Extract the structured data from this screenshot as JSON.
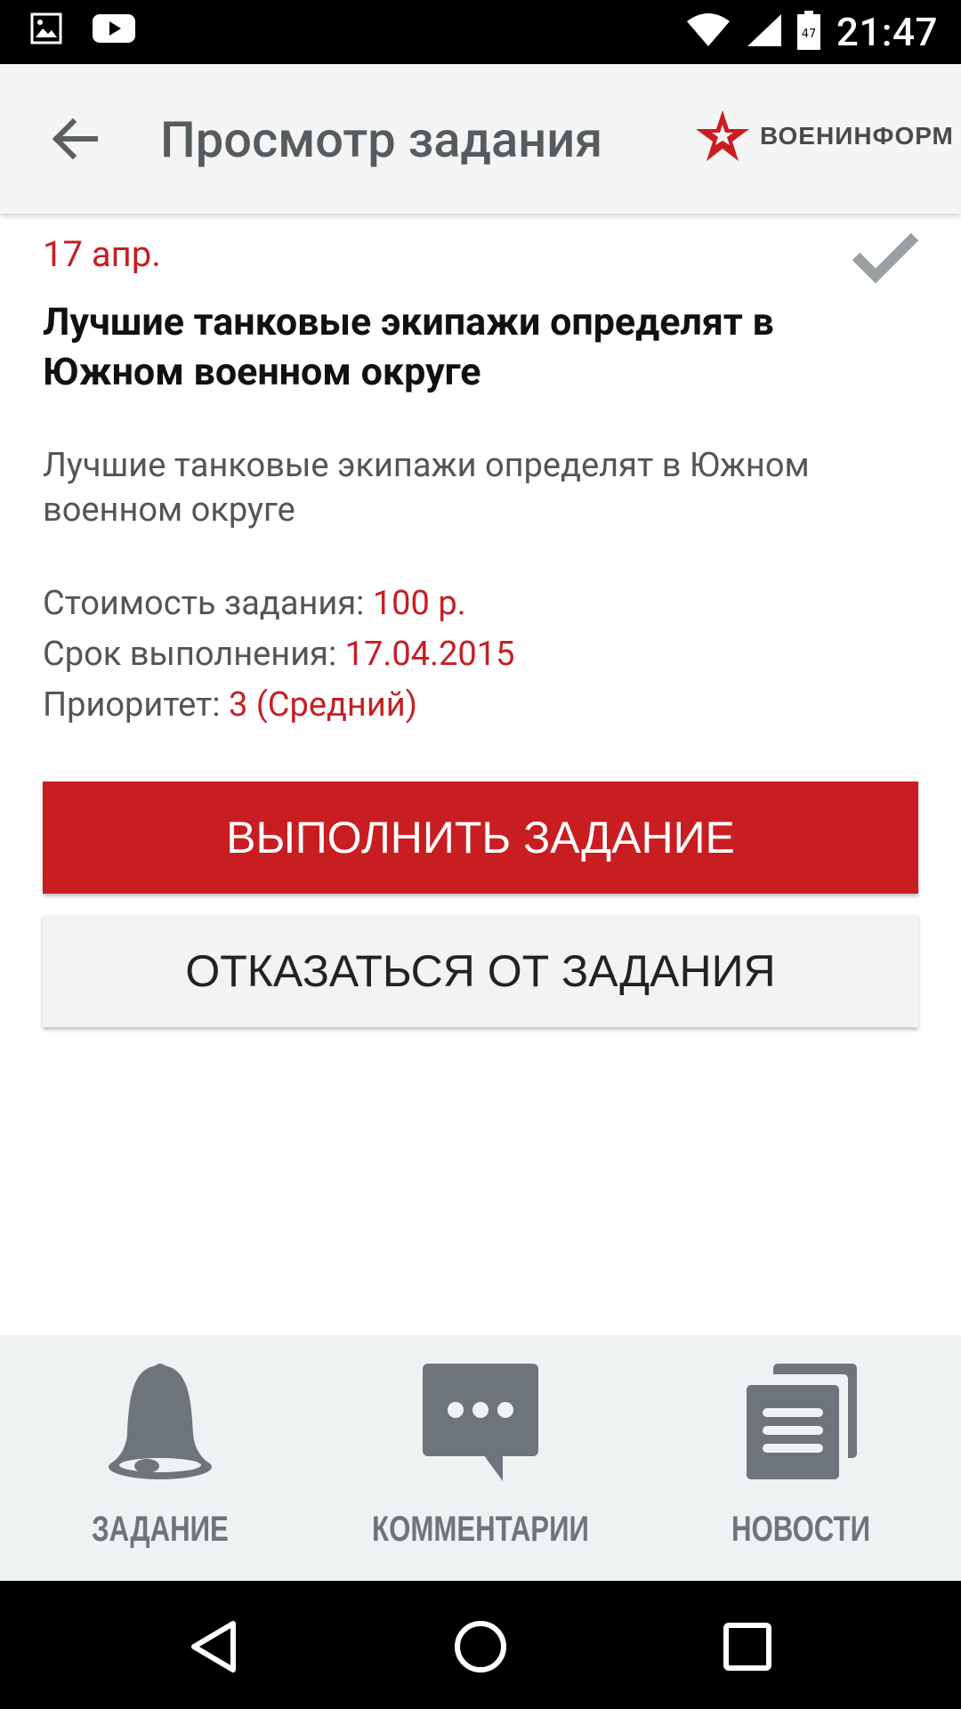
{
  "status_bar": {
    "time": "21:47",
    "left_icons": [
      "image-icon",
      "youtube-icon"
    ],
    "right_icons": [
      "wifi-icon",
      "signal-icon",
      "battery-icon"
    ],
    "battery_level": "47"
  },
  "app_bar": {
    "title": "Просмотр задания",
    "brand": "ВОЕНИНФОРМ"
  },
  "task": {
    "date": "17 апр.",
    "title": "Лучшие танковые экипажи определят в Южном военном округе",
    "description": "Лучшие танковые экипажи определят в Южном военном округе",
    "cost_label": "Стоимость задания: ",
    "cost_value": "100 р.",
    "deadline_label": "Срок выполнения: ",
    "deadline_value": "17.04.2015",
    "priority_label": "Приоритет: ",
    "priority_value": "3 (Средний)"
  },
  "actions": {
    "complete": "ВЫПОЛНИТЬ ЗАДАНИЕ",
    "decline": "ОТКАЗАТЬСЯ ОТ ЗАДАНИЯ"
  },
  "bottom_nav": {
    "items": [
      {
        "label": "ЗАДАНИЕ",
        "icon": "bell-icon"
      },
      {
        "label": "КОММЕНТАРИИ",
        "icon": "comment-icon"
      },
      {
        "label": "НОВОСТИ",
        "icon": "news-icon"
      }
    ]
  },
  "colors": {
    "accent": "#c91e21",
    "icon_gray": "#6e757a",
    "nav_bg": "#eff2f3"
  }
}
